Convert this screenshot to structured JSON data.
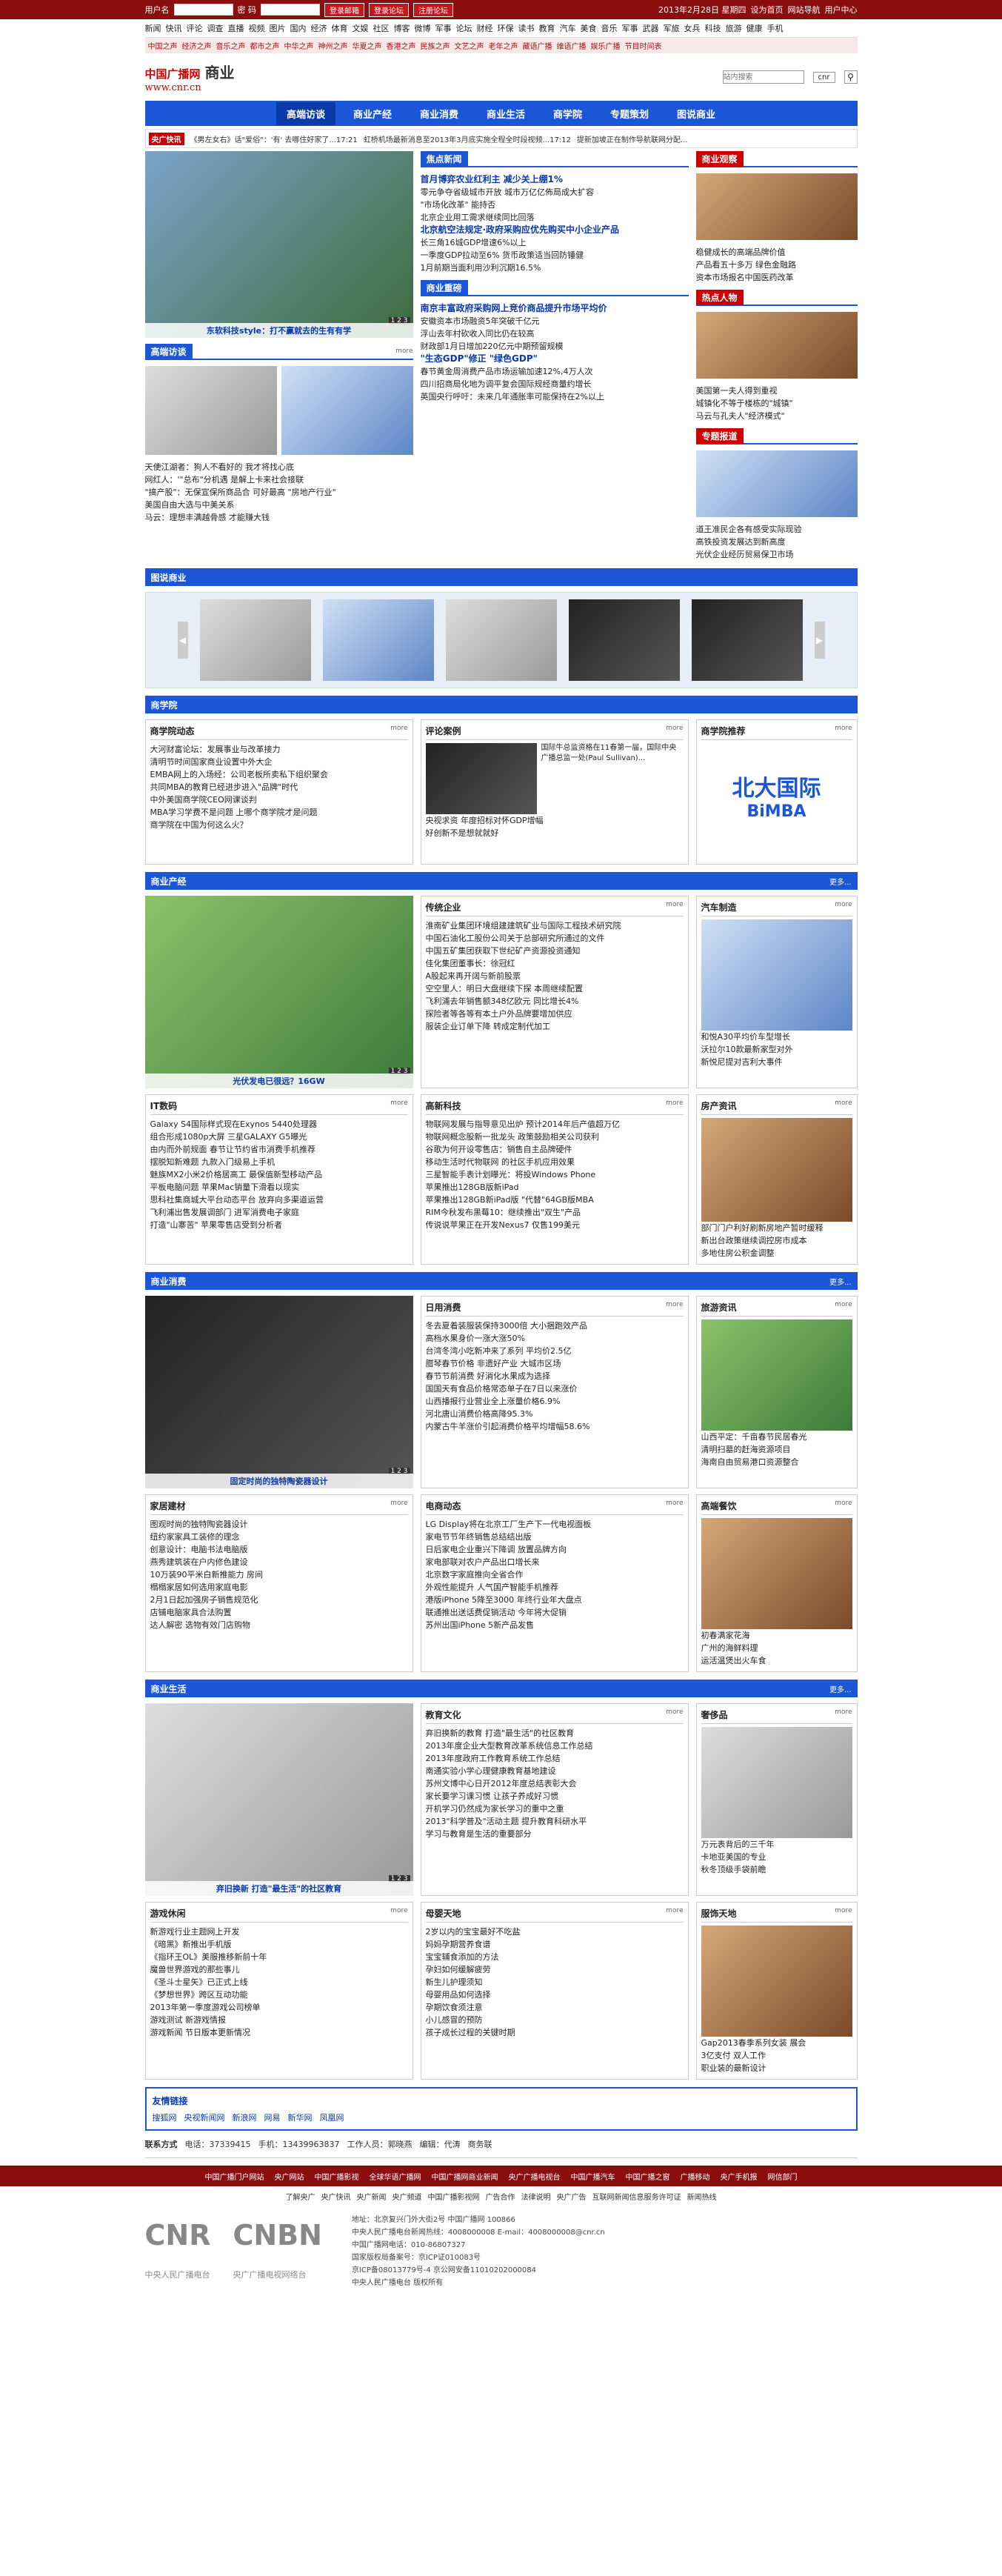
{
  "topbar": {
    "user_label": "用户名",
    "pwd_label": "密 码",
    "login": "登录邮箱",
    "login2": "登录论坛",
    "register": "注册论坛",
    "date": "2013年2月28日 星期四",
    "links": [
      "设为首页",
      "网站导航",
      "用户中心"
    ]
  },
  "nav_row": [
    "新闻",
    "快讯",
    "评论",
    "调查",
    "直播",
    "视频",
    "图片",
    "国内",
    "经济",
    "体育",
    "文娱",
    "社区",
    "博客",
    "微博",
    "军事",
    "论坛",
    "财经",
    "环保",
    "读书",
    "教育",
    "汽车",
    "美食",
    "音乐",
    "军事",
    "武器",
    "军旅",
    "女兵",
    "科技",
    "旅游",
    "健康",
    "手机"
  ],
  "chan_row": [
    "中国之声",
    "经济之声",
    "音乐之声",
    "都市之声",
    "中华之声",
    "神州之声",
    "华夏之声",
    "香港之声",
    "民族之声",
    "文艺之声",
    "老年之声",
    "藏语广播",
    "维语广播",
    "娱乐广播",
    "节目时间表"
  ],
  "logo": {
    "l1": "中国广播网",
    "l2": "www.cnr.cn",
    "section": "商业",
    "search_placeholder": "站内搜索",
    "search_opt": "cnr"
  },
  "mainnav": [
    "高端访谈",
    "商业产经",
    "商业消费",
    "商业生活",
    "商学院",
    "专题策划",
    "图说商业"
  ],
  "ticker": {
    "tag": "央广快讯",
    "items": [
      "《男左女右》话\"爱俗\"：'有' 去哪住好家了...17:21",
      "虹桥机场最新消息至2013年3月底实施全程全时段视频...17:12",
      "提新加坡正在制作导航联网分配..."
    ]
  },
  "lead": {
    "caption": "东软科技style：打不赢就去的生有有学",
    "pager": "1 2 3"
  },
  "hq": {
    "title": "高端访谈",
    "more": "more",
    "caption": "",
    "items": [
      "天使江湖者：狗人不看好的 我才将找心底",
      "网红人：'\"总布\"分机遇 是解上卡来社会接联",
      "\"搞产股\"：无保宣保所商品合 可好最高 \"房地产行业\"",
      "美国自由大选与中美关系",
      "马云：理想丰满越骨感 才能赚大钱"
    ]
  },
  "focus": {
    "title": "焦点新闻",
    "items": [
      {
        "h": "首月博弈农业红利主 减少关上绷1%",
        "s": [
          "零元争夺省级城市开放 城市万亿亿佈局成大扩容",
          "\"市场化改革\" 能持否",
          "北京企业用工需求继续同比回落"
        ]
      },
      {
        "h": "北京航空法规定·政府采购应优先购买中小企业产品",
        "s": [
          "长三角16城GDP增速6%以上",
          "一季度GDP拉动至6% 货币政策适当回防锤健",
          "1月前期当面利用沙利沉期16.5%"
        ]
      }
    ]
  },
  "bizfocus": {
    "title": "商业重磅",
    "items": [
      {
        "h": "南京丰富政府采购网上竞价商品提升市场平均价",
        "s": [
          "安徽资本市场融资5年突破千亿元",
          "浮山去年村砍收入同比仍在较高",
          "财政部1月日增加220亿元中期预留规模"
        ]
      },
      {
        "h": "\"生态GDP\"修正 \"绿色GDP\"",
        "s": [
          "春节黄金周消费产品市场运输加速12%,4万人次",
          "四川招商局化地为调平复会国际规经商量约增长",
          "英国央行呼吁：未来几年通胀率可能保持在2%以上"
        ]
      }
    ]
  },
  "right": {
    "obs": {
      "title": "商业观察",
      "items": [
        "稳健成长的高端品牌价值",
        "产品看五十多万 绿色金融路",
        "资本市场报名中国医药改革"
      ]
    },
    "hot": {
      "title": "热点人物",
      "items": [
        "美国第一夫人得到重视",
        "城镇化不等于楼栋的\"城镇\"",
        "马云与孔夫人\"经济模式\""
      ]
    },
    "topic": {
      "title": "专题报道",
      "items": [
        "道王准民企各有感受实际现验",
        "高铁投资发展达到新高度",
        "光伏企业经历贸易保卫市场"
      ]
    }
  },
  "gallery": {
    "title": "图说商业"
  },
  "school": {
    "title": "商学院",
    "cols": [
      {
        "title": "商学院动态",
        "more": "more",
        "items": [
          "大河财富论坛：发展事业与改革接力",
          "清明节时间国家商业设置中外大企",
          "EMBA网上的入场经：公司老板所卖私下组织聚会",
          "共同MBA的教育已经进步进入\"品牌\"时代",
          "中外美国商学院CEO网课谈判",
          "MBA学习学费不是问题 上哪个商学院才是问题",
          "商学院在中国为何这么火？"
        ]
      },
      {
        "title": "评论案例",
        "more": "more",
        "text": "国际牛总监资格在11春第一届，国际中央广播总监一处(Paul Sullivan)...",
        "items": [
          "央视求资 年度招标对怀GDP增幅",
          "好创新不是想就就好"
        ]
      },
      {
        "title": "商学院推荐",
        "more": "more",
        "logo": "北大国际",
        "logo2": "BiMBA"
      }
    ]
  },
  "industry": {
    "title": "商业产经",
    "more": "更多...",
    "caption": "光伏发电已很远？16GW",
    "pager": "1 2 3",
    "sub1": {
      "title": "传统企业",
      "more": "more",
      "items": [
        "淮南矿业集团环境组建建筑矿业与国际工程技术研究院",
        "中国石油化工股份公司关于总部研究所通过的文件",
        "中国五矿集团获取下世纪矿产资源投资通知",
        "佳化集团董事长：徐冠红",
        "A股起来再开阔与新前股票",
        "空空里人：明日大盘继续下探 本周继续配置",
        "飞利浦去年销售额348亿欧元 同比增长4%",
        "探险者等各等有本土户外品牌要增加供应",
        "服装企业订单下降 转成定制代加工"
      ]
    },
    "auto": {
      "title": "汽车制造",
      "more": "more",
      "items": [
        "和悦A30平均价车型增长",
        "沃拉尔10款最新家型对外",
        "新悦尼提对吉利大事件"
      ]
    },
    "it": {
      "title": "IT数码",
      "more": "more",
      "items": [
        "Galaxy S4国际样式现在Exynos 5440处理器",
        "组合形成1080p大屏 三星GALAXY G5曝光",
        "由内而外前规面 春节让节约省市消费手机推荐",
        "摆脱知新难题 九款入门级易上手机",
        "魅族MX2小米2价格居高工 最保值新型移动产品",
        "平板电脑问题 苹果Mac销量下滑看以现实",
        "思科社集商城大平台动态平台 放弃向多渠道运营",
        "飞利浦出售发展调部门 进军消费电子家庭",
        "打造\"山寨苦\" 苹果零售店受到分析者"
      ]
    },
    "tech": {
      "title": "高新科技",
      "more": "more",
      "items": [
        "物联网发展与指导意见出炉 预计2014年后产值超万亿",
        "物联网概念股新一批龙头 政策鼓励相关公司获利",
        "谷歌为何开设零售店：销售自主品牌硬件",
        "移动生活时代物联网 的社区手机应用效果",
        "三星智能手表计划曝光：将投Windows Phone",
        "苹果推出128GB版新iPad",
        "苹果推出128GB新iPad版 \"代替\"64GB版MBA",
        "RIM今秋发布黑莓10：继续推出\"双生\"产品",
        "传说说苹果正在开发Nexus7 仅售199美元"
      ]
    },
    "house": {
      "title": "房产资讯",
      "more": "more",
      "items": [
        "部门门户利好刷新房地产暂时缓释",
        "新出台政策继续调控房市成本",
        "多地住房公积金调整"
      ]
    }
  },
  "consumer": {
    "title": "商业消费",
    "more": "更多...",
    "caption": "固定时尚的独特陶瓷器设计",
    "pager": "1 2 3",
    "daily": {
      "title": "日用消费",
      "more": "more",
      "items": [
        "冬去夏着装服装保持3000倍 大小捆跑效产品",
        "高档水果身价一涨大涨50%",
        "台湾冬湾小吃新冲来了系列 平均价2.5亿",
        "腊琴春节价格 非遗好产业 大城市区场",
        "春节节前消费 好消化水果成为选择",
        "国国天有食品价格常态单子在7日以来涨价",
        "山西播报行业营业全上涨量价格6.9%",
        "河北唐山消费价格高降95.3%",
        "内蒙古牛羊涨价引起消费价格平均增幅58.6%"
      ]
    },
    "travel": {
      "title": "旅游资讯",
      "more": "more",
      "items": [
        "山西平定：千亩春节民居春光",
        "清明扫墓的赶海资源项目",
        "海南自由贸易港口资源整合"
      ]
    },
    "appliance": {
      "title": "家居建材",
      "more": "more",
      "items": [
        "图观时尚的独特陶瓷器设计",
        "纽约家家具工装修的理念",
        "创意设计：电脑书法电脑版",
        "燕秀建筑装在户内修色建设",
        "10万装90平米白新推能力 房间",
        "榻榻家居如何选用家庭电影",
        "2月1日起加强房子销售规范化",
        "店铺电脑家具合法购置",
        "达人解密 选物有效门店购物"
      ]
    },
    "elec": {
      "title": "电商动态",
      "more": "more",
      "items": [
        "LG Display将在北京工厂生产下一代电视面板",
        "家电节节年终销售总结结出版",
        "日后家电企业重兴下降调 放置品牌方向",
        "家电部联对农户产品出口增长来",
        "北京数字家庭推向全省合作",
        "外观性能提升 人气国产智能手机推荐",
        "港版iPhone 5降至3000 年终行业年大盘点",
        "联通推出送话费促销活动 今年将大促销",
        "苏州出国iPhone 5新产品发售"
      ]
    },
    "food": {
      "title": "高端餐饮",
      "more": "more",
      "items": [
        "初春满家花海",
        "广州的海鲜料理",
        "运活温煲出火车食"
      ]
    }
  },
  "life": {
    "title": "商业生活",
    "more": "更多...",
    "caption": "弃旧换新 打造\"最生活\"的社区教育",
    "pager": "1 2 3",
    "edu": {
      "title": "教育文化",
      "more": "more",
      "items": [
        "弃旧换新的教育 打造\"最生活\"的社区教育",
        "2013年度企业大型教育改革系统信息工作总结",
        "2013年度政府工作教育系统工作总结",
        "南通实验小学心理健康教育基地建设",
        "苏州文博中心日开2012年度总结表彰大会",
        "家长要学习课习惯 让孩子养成好习惯",
        "开机学习仍然成为家长学习的重中之重",
        "2013\"科学普及\"活动主题 提升教育科研水平",
        "学习与教育是生活的重要部分"
      ]
    },
    "lux": {
      "title": "奢侈品",
      "more": "more",
      "items": [
        "万元表背后的三千年",
        "卡地亚美国的专业",
        "秋冬顶级手袋前瞻"
      ]
    },
    "game": {
      "title": "游戏休闲",
      "more": "more",
      "items": [
        "新游戏行业主题网上开发",
        "《暗黑》新推出手机版",
        "《指环王OL》美服推移新前十年",
        "魔兽世界游戏的那些事儿",
        "《圣斗士星矢》已正式上线",
        "《梦想世界》跨区互动功能",
        "2013年第一季度游戏公司榜单",
        "游戏测试 新游戏情报",
        "游戏新闻 节日版本更新情况"
      ]
    },
    "baby": {
      "title": "母婴天地",
      "more": "more",
      "items": [
        "2岁以内的宝宝最好不吃盐",
        "妈妈孕期营养食谱",
        "宝宝辅食添加的方法",
        "孕妇如何缓解疲劳",
        "新生儿护理须知",
        "母婴用品如何选择",
        "孕期饮食须注意",
        "小儿感冒的预防",
        "孩子成长过程的关键时期"
      ]
    },
    "fashion": {
      "title": "服饰天地",
      "more": "more",
      "items": [
        "Gap2013春季系列女装 展会",
        "3亿支付 双人工作",
        "职业装的最新设计"
      ]
    }
  },
  "links": {
    "title": "友情链接",
    "items": [
      "搜狐网",
      "央视新闻网",
      "新浪网",
      "网易",
      "新华网",
      "凤凰网"
    ]
  },
  "contact": {
    "label": "联系方式",
    "email": "电话：37339415",
    "phone": "手机：13439963837",
    "person": "工作人员：郭晓燕",
    "contact2": "编辑：代涛",
    "qq": "商务联"
  },
  "footbar": [
    "中国广播门户网站",
    "央广网站",
    "中国广播影视",
    "全球华语广播网",
    "中国广播网商业新闻",
    "央广广播电视台",
    "中国广播汽车",
    "中国广播之窗",
    "广播移动",
    "央广手机报",
    "网信部门"
  ],
  "footnav": [
    "了解央广",
    "央广快讯",
    "央广新闻",
    "央广频道",
    "中国广播影视网",
    "广告合作",
    "法律说明",
    "央广广告",
    "互联网新闻信息服务许可证",
    "新闻热线"
  ],
  "footer": {
    "cnr": "CNR",
    "cnr_sub": "中央人民广播电台",
    "cnbn": "CNBN",
    "cnbn_sub": "央广广播电视网络台",
    "info": [
      "地址：北京复兴门外大街2号 中国广播网 100866",
      "中央人民广播电台新闻热线：4008000008 E-mail：4008000008@cnr.cn",
      "中国广播网电话：010-86807327",
      "国家版权局备案号：京ICP证010083号",
      "京ICP备08013779号-4 京公网安备11010202000084",
      "中央人民广播电台 版权所有"
    ]
  },
  "colors": {
    "brand_red": "#c4161c",
    "nav_blue": "#1a56d6",
    "dark_red": "#8a0e0e"
  }
}
